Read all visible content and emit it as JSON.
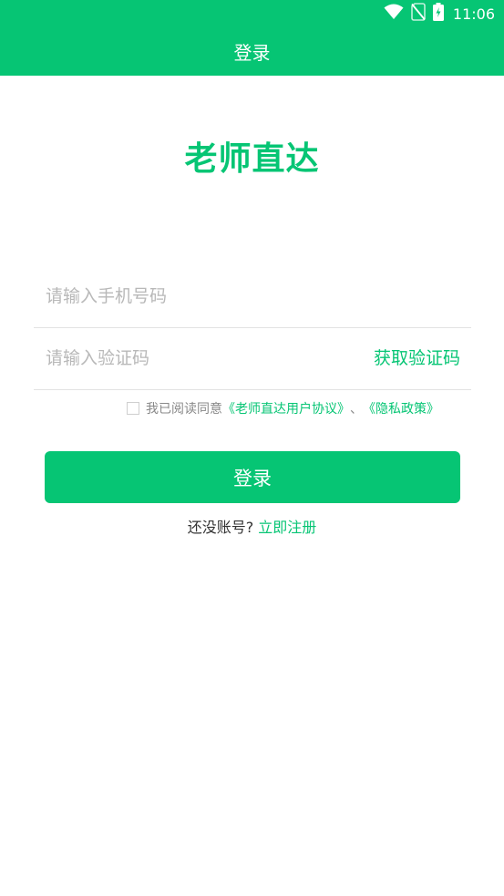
{
  "status_bar": {
    "time": "11:06",
    "icons": [
      "wifi-icon",
      "no-sim-icon",
      "battery-charging-icon"
    ]
  },
  "nav": {
    "title": "登录"
  },
  "app": {
    "title": "老师直达"
  },
  "form": {
    "phone_placeholder": "请输入手机号码",
    "phone_value": "",
    "code_placeholder": "请输入验证码",
    "code_value": "",
    "get_code_label": "获取验证码"
  },
  "agreement": {
    "checked": false,
    "prefix": "我已阅读同意",
    "user_agreement": "《老师直达用户协议》",
    "separator": "、",
    "privacy_policy": "《隐私政策》"
  },
  "login_button": {
    "label": "登录"
  },
  "register": {
    "prompt": "还没账号?",
    "link": "立即注册"
  },
  "colors": {
    "accent": "#06c574",
    "placeholder": "#b8b8b8",
    "divider": "#e3e3e3"
  }
}
